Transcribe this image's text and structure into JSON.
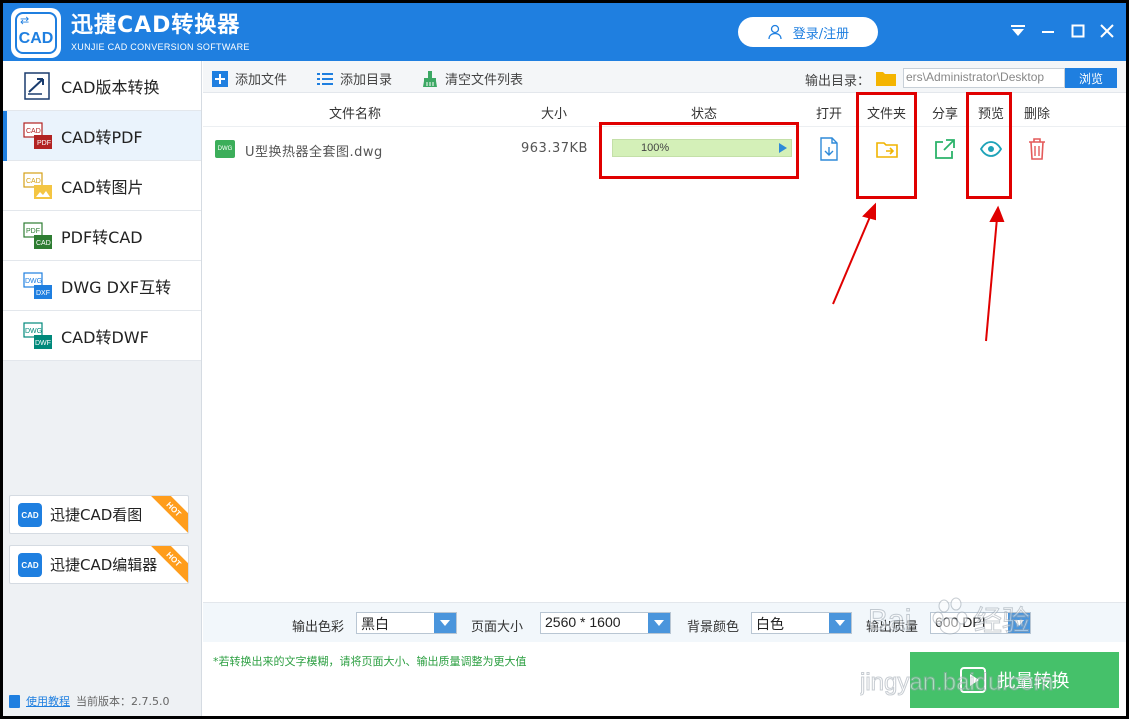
{
  "app": {
    "title": "迅捷CAD转换器",
    "subtitle": "XUNJIE CAD CONVERSION SOFTWARE",
    "logo_text": "CAD",
    "login_label": "登录/注册"
  },
  "sidebar": {
    "items": [
      {
        "label": "CAD版本转换",
        "icon": "cad-version-icon",
        "active": false
      },
      {
        "label": "CAD转PDF",
        "icon": "cad-to-pdf-icon",
        "active": true
      },
      {
        "label": "CAD转图片",
        "icon": "cad-to-image-icon",
        "active": false
      },
      {
        "label": "PDF转CAD",
        "icon": "pdf-to-cad-icon",
        "active": false
      },
      {
        "label": "DWG DXF互转",
        "icon": "dwg-dxf-icon",
        "active": false
      },
      {
        "label": "CAD转DWF",
        "icon": "cad-to-dwf-icon",
        "active": false
      }
    ],
    "promos": [
      {
        "label": "迅捷CAD看图",
        "badge": "HOT",
        "icon_text": "CAD"
      },
      {
        "label": "迅捷CAD编辑器",
        "badge": "HOT",
        "icon_text": "CAD"
      }
    ],
    "help_label": "使用教程",
    "version_label": "当前版本：2.7.5.0"
  },
  "toolbar": {
    "add_file": "添加文件",
    "add_dir": "添加目录",
    "clear_list": "清空文件列表",
    "output_dir_label": "输出目录：",
    "output_dir_value": "ers\\Administrator\\Desktop",
    "browse": "浏览"
  },
  "table": {
    "headers": {
      "name": "文件名称",
      "size": "大小",
      "status": "状态",
      "open": "打开",
      "folder": "文件夹",
      "share": "分享",
      "preview": "预览",
      "delete": "删除"
    },
    "rows": [
      {
        "icon_text": "DWG",
        "name": "U型换热器全套图.dwg",
        "size": "963.37KB",
        "progress": 100,
        "progress_text": "100%"
      }
    ]
  },
  "settings": {
    "color_label": "输出色彩",
    "color_value": "黑白",
    "page_label": "页面大小",
    "page_value": "2560 * 1600",
    "bg_label": "背景颜色",
    "bg_value": "白色",
    "quality_label": "输出质量",
    "quality_value": "600 DPI"
  },
  "hint": "*若转换出来的文字模糊，请将页面大小、输出质量调整为更大值",
  "convert_label": "批量转换",
  "watermark": {
    "line1": "Bai",
    "line2": "经验",
    "line3": "jingyan.baidu.com"
  },
  "colors": {
    "brand": "#1f7fe0",
    "convert": "#45c16a",
    "annotation": "#e00000"
  }
}
